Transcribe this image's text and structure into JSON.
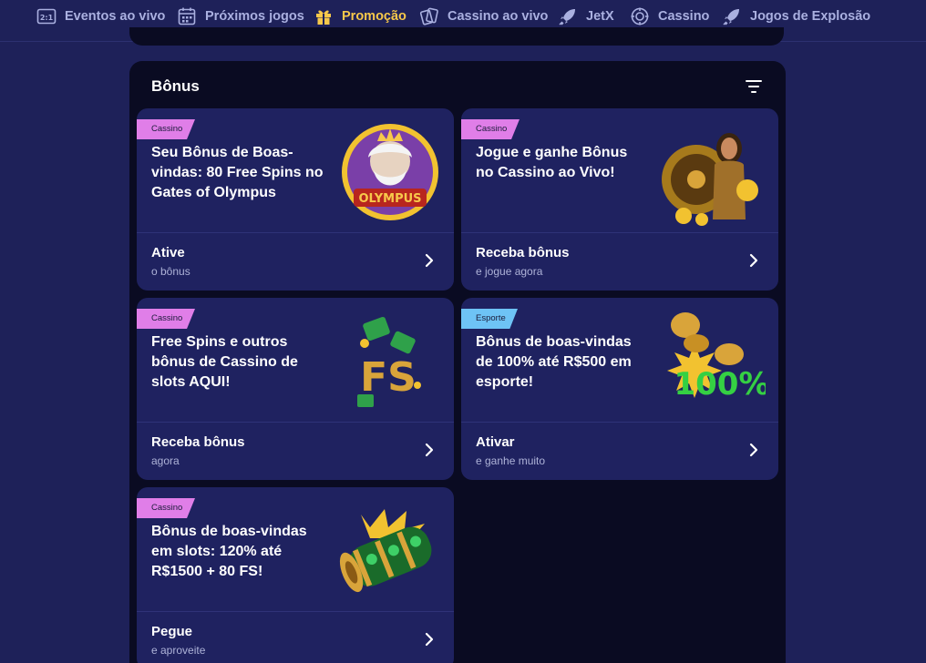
{
  "nav": {
    "items": [
      {
        "label": "Eventos ao vivo",
        "icon": "live-events-icon"
      },
      {
        "label": "Próximos jogos",
        "icon": "calendar-icon"
      },
      {
        "label": "Promoção",
        "icon": "gift-icon",
        "active": true
      },
      {
        "label": "Cassino ao vivo",
        "icon": "cards-icon"
      },
      {
        "label": "JetX",
        "icon": "rocket-icon"
      },
      {
        "label": "Cassino",
        "icon": "chip-icon"
      },
      {
        "label": "Jogos de Explosão",
        "icon": "rocket-icon"
      }
    ],
    "live_badge": "2:1"
  },
  "colors": {
    "background": "#1e2159",
    "panel": "#0a0b22",
    "card": "#1f2260",
    "active_nav": "#f7c84a",
    "tag_cassino": "#e07ee8",
    "tag_esporte": "#6ec3f5"
  },
  "bonus": {
    "title": "Bônus",
    "cards": [
      {
        "tag": "Cassino",
        "title": "Seu Bônus de Boas-vindas: 80 Free Spins no Gates of Olympus",
        "action": "Ative",
        "sub": "o bônus",
        "art": "gates-of-olympus-art"
      },
      {
        "tag": "Cassino",
        "title": "Jogue e ganhe Bônus no Cassino ao Vivo!",
        "action": "Receba bônus",
        "sub": "e jogue agora",
        "art": "live-casino-dealer-art"
      },
      {
        "tag": "Cassino",
        "title": "Free Spins e outros bônus de Cassino de slots AQUI!",
        "action": "Receba bônus",
        "sub": "agora",
        "art": "free-spins-art"
      },
      {
        "tag": "Esporte",
        "title": "Bônus de boas-vindas de 100% até R$500 em esporte!",
        "action": "Ativar",
        "sub": "e ganhe muito",
        "art": "hundred-percent-art"
      },
      {
        "tag": "Cassino",
        "title": "Bônus de boas-vindas em slots: 120% até R$1500 + 80 FS!",
        "action": "Pegue",
        "sub": "e aproveite",
        "art": "slot-reel-art"
      }
    ]
  }
}
